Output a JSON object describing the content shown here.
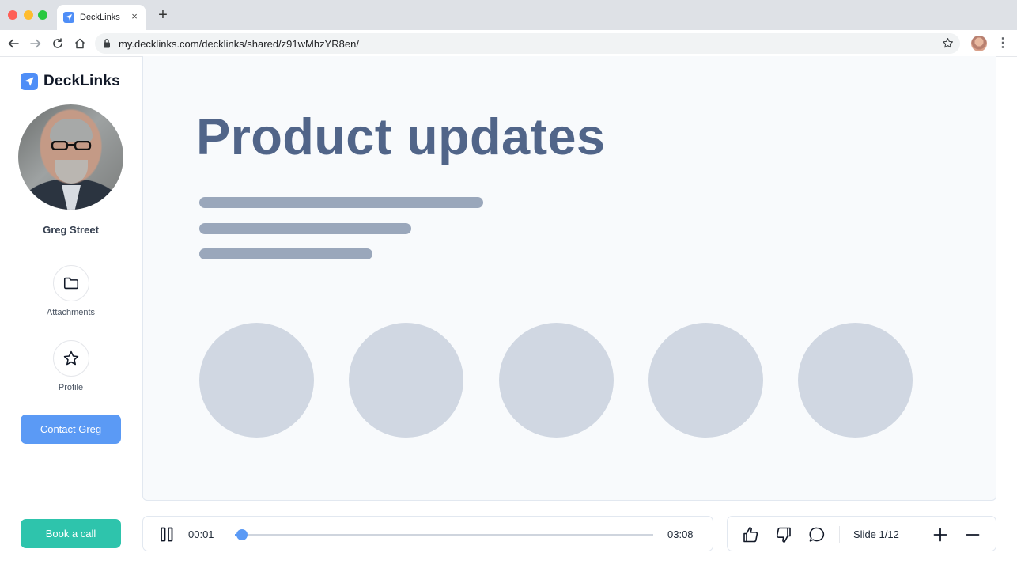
{
  "browser": {
    "tab_title": "DeckLinks",
    "tab_close": "×",
    "new_tab": "+",
    "url": "my.decklinks.com/decklinks/shared/z91wMhzYR8en/",
    "menu": "⋮"
  },
  "sidebar": {
    "brand": "DeckLinks",
    "person_name": "Greg Street",
    "actions": [
      {
        "label": "Attachments",
        "icon": "folder-icon"
      },
      {
        "label": "Profile",
        "icon": "star-icon"
      }
    ],
    "contact_label": "Contact Greg",
    "book_label": "Book a call"
  },
  "slide": {
    "title": "Product updates",
    "placeholder_circles": 5
  },
  "player": {
    "current_time": "00:01",
    "total_time": "03:08",
    "progress": 0.017
  },
  "controls": {
    "slide_counter": "Slide 1/12",
    "icons": [
      "thumbs-up-icon",
      "thumbs-down-icon",
      "comment-icon",
      "zoom-in-icon",
      "zoom-out-icon"
    ]
  },
  "colors": {
    "brand_blue": "#4f8ef7",
    "contact_button": "#5b9af5",
    "book_button": "#2ec4ac",
    "slide_title": "#516589"
  }
}
